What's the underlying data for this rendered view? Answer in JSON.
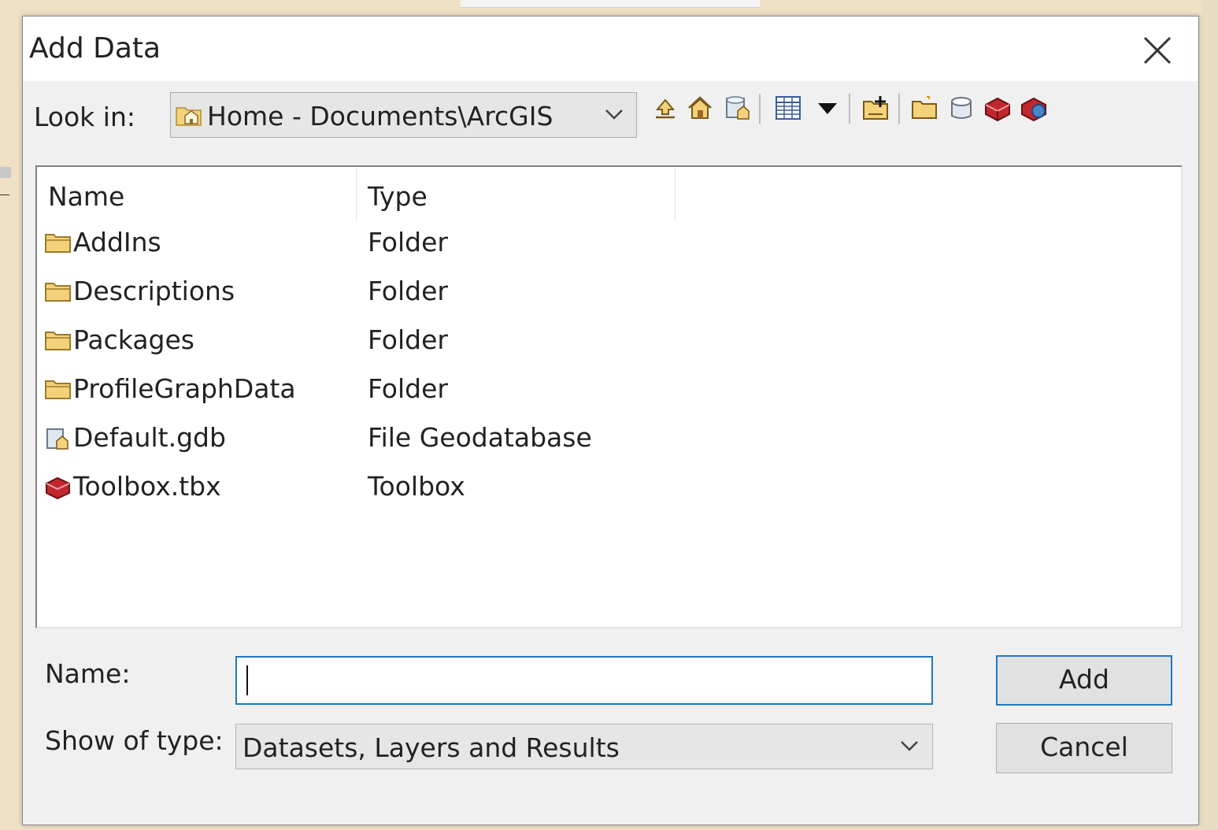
{
  "dialog": {
    "title": "Add Data",
    "close_icon": "close-icon"
  },
  "lookin": {
    "label": "Look in:",
    "value": "Home - Documents\\ArcGIS",
    "icon": "home-folder-icon"
  },
  "toolbar": {
    "icons": [
      "up-one-level-icon",
      "home-icon",
      "default-geodatabase-icon",
      "list-view-icon",
      "view-options-dropdown-icon",
      "connect-to-folder-icon",
      "new-folder-icon",
      "new-database-icon",
      "new-toolbox-icon",
      "new-layer-icon"
    ]
  },
  "filelist": {
    "columns": [
      "Name",
      "Type"
    ],
    "rows": [
      {
        "name": "AddIns",
        "type": "Folder",
        "icon": "folder-icon"
      },
      {
        "name": "Descriptions",
        "type": "Folder",
        "icon": "folder-icon"
      },
      {
        "name": "Packages",
        "type": "Folder",
        "icon": "folder-icon"
      },
      {
        "name": "ProfileGraphData",
        "type": "Folder",
        "icon": "folder-icon"
      },
      {
        "name": "Default.gdb",
        "type": "File Geodatabase",
        "icon": "geodatabase-icon"
      },
      {
        "name": "Toolbox.tbx",
        "type": "Toolbox",
        "icon": "toolbox-icon"
      }
    ]
  },
  "form": {
    "name_label": "Name:",
    "name_value": "",
    "type_label": "Show of type:",
    "type_value": "Datasets, Layers and Results"
  },
  "buttons": {
    "add": "Add",
    "cancel": "Cancel"
  },
  "colors": {
    "accent": "#1f79c4",
    "dialog_bg": "#f0f0f0",
    "background": "#efe0c6"
  }
}
